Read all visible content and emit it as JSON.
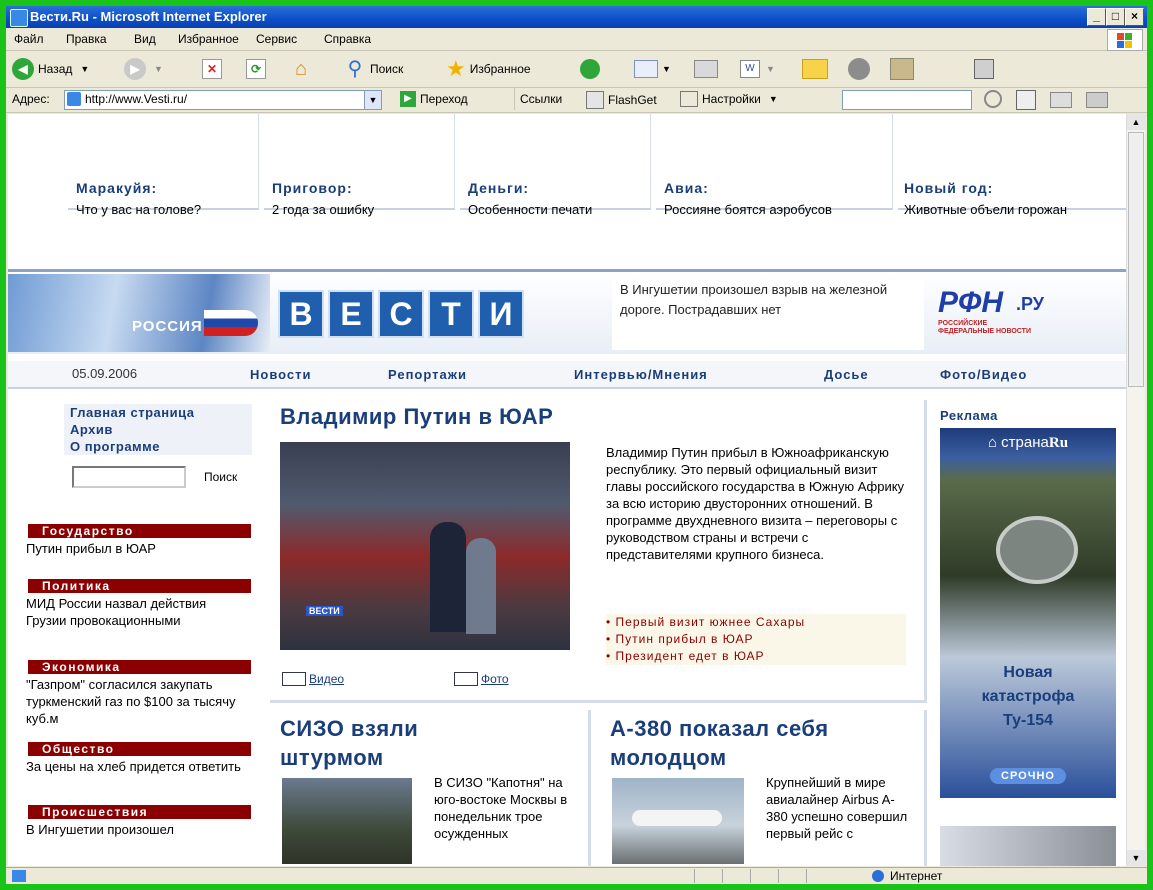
{
  "window": {
    "title": "Вести.Ru - Microsoft Internet Explorer",
    "min": "_",
    "max": "□",
    "close": "×"
  },
  "menu": [
    "Файл",
    "Правка",
    "Вид",
    "Избранное",
    "Сервис",
    "Справка"
  ],
  "toolbar": {
    "back": "Назад",
    "search": "Поиск",
    "favorites": "Избранное"
  },
  "address": {
    "label": "Адрес:",
    "url": "http://www.Vesti.ru/",
    "go": "Переход",
    "links": "Ссылки",
    "flashget": "FlashGet",
    "settings": "Настройки"
  },
  "teasers": [
    {
      "head": "Маракуйя:",
      "text": "Что у вас на голове?"
    },
    {
      "head": "Приговор:",
      "text": "2 года за ошибку"
    },
    {
      "head": "Деньги:",
      "text": "Особенности печати"
    },
    {
      "head": "Авиа:",
      "text": "Россияне боятся аэробусов"
    },
    {
      "head": "Новый год:",
      "text": "Животные объели горожан"
    }
  ],
  "banner": {
    "russia": "РОССИЯ",
    "vesti_letters": [
      "В",
      "Е",
      "С",
      "Т",
      "И"
    ],
    "ticker": "В Ингушетии произошел взрыв на железной дороге. Пострадавших нет",
    "rfn_logo": "РФН",
    "rfn_ru": ".РУ",
    "rfn_sub1": "РОССИЙСКИЕ",
    "rfn_sub2": "ФЕДЕРАЛЬНЫЕ НОВОСТИ"
  },
  "nav": {
    "date": "05.09.2006",
    "items": [
      "Новости",
      "Репортажи",
      "Интервью/Мнения",
      "Досье",
      "Фото/Видео"
    ]
  },
  "left": {
    "links": [
      "Главная страница",
      "Архив",
      "О программе"
    ],
    "search_button": "Поиск",
    "sections": [
      {
        "head": "Государство",
        "text": "Путин прибыл в ЮАР"
      },
      {
        "head": "Политика",
        "text": "МИД России назвал действия Грузии провокационными"
      },
      {
        "head": "Экономика",
        "text": "\"Газпром\" согласился закупать туркменский газ по $100 за тысячу куб.м"
      },
      {
        "head": "Общество",
        "text": "За цены на хлеб придется ответить"
      },
      {
        "head": "Происшествия",
        "text": "В Ингушетии произошел"
      }
    ]
  },
  "main": {
    "headline": "Владимир Путин в ЮАР",
    "photo_caption": "ВЕСТИ",
    "body": "Владимир Путин прибыл в Южноафриканскую республику. Это первый официальный визит главы российского государства в Южную Африку за всю историю двусторонних отношений. В программе двухдневного визита – переговоры с руководством страны и встречи с представителями крупного бизнеса.",
    "bullets": [
      "Первый визит южнее Сахары",
      "Путин прибыл в ЮАР",
      "Президент едет в ЮАР"
    ],
    "video": "Видео",
    "photo": "Фото"
  },
  "story2": {
    "headline_line1": "СИЗО взяли",
    "headline_line2": "штурмом",
    "text": "В СИЗО \"Капотня\" на юго-востоке Москвы в понедельник трое осужденных"
  },
  "story3": {
    "headline_line1": "A-380 показал себя",
    "headline_line2": "молодцом",
    "text": "Крупнейший в мире авиалайнер Airbus A-380 успешно совершил первый рейс с"
  },
  "ad": {
    "label": "Реклама",
    "brand_prefix": "страна",
    "brand_suffix": "Ru",
    "line1": "Новая",
    "line2": "катастрофа",
    "line3": "Ту-154",
    "urgent": "СРОЧНО"
  },
  "status": {
    "zone": "Интернет"
  }
}
